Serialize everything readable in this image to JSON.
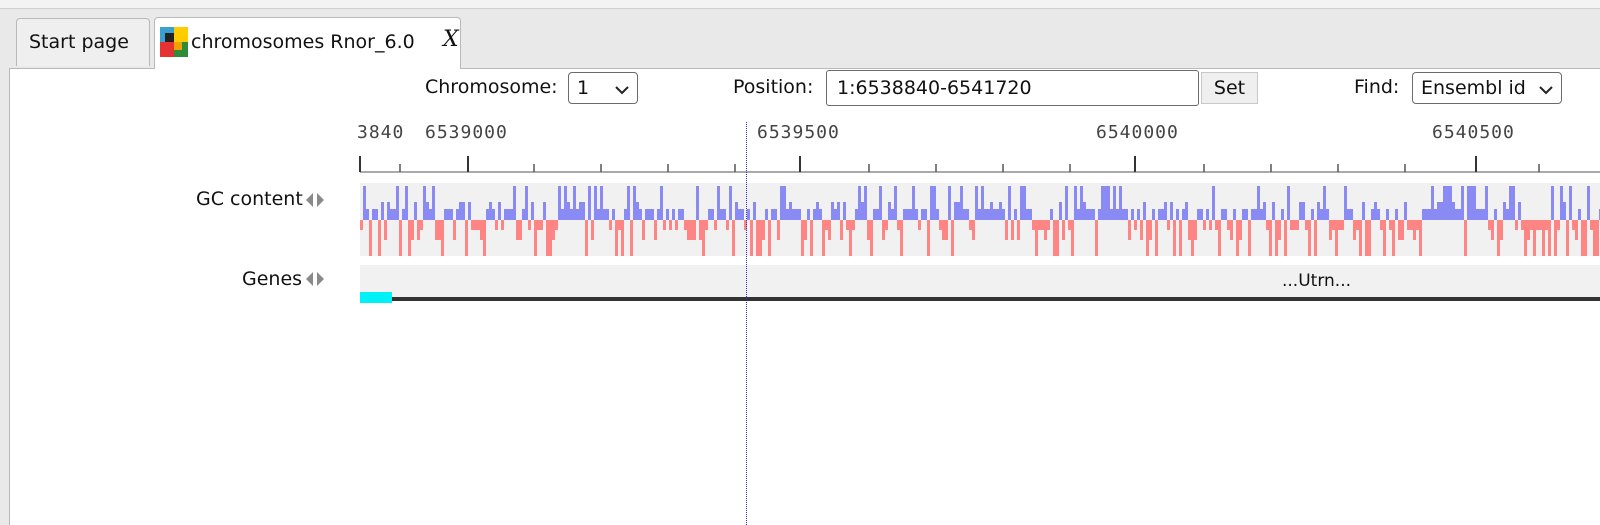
{
  "tabs": [
    {
      "label": "Start page",
      "active": false
    },
    {
      "label": "chromosomes Rnor_6.0",
      "active": true,
      "close": "X"
    }
  ],
  "controls": {
    "chromosome_label": "Chromosome:",
    "chromosome_value": "1",
    "position_label": "Position:",
    "position_value": "1:6538840-6541720",
    "set_label": "Set",
    "find_label": "Find:",
    "find_value": "Ensembl id"
  },
  "ruler": {
    "labels": [
      "3840",
      "6539000",
      "6539500",
      "6540000",
      "6540500"
    ]
  },
  "tracks": {
    "gc_label": "GC content",
    "genes_label": "Genes",
    "gene_name": "...Utrn..."
  },
  "colors": {
    "gc_high": "#8a8af5",
    "gc_low": "#ff8585",
    "track_bg": "#f1f1f1",
    "gene_exon": "#00f0f8",
    "cursor": "#2a2ad6"
  }
}
